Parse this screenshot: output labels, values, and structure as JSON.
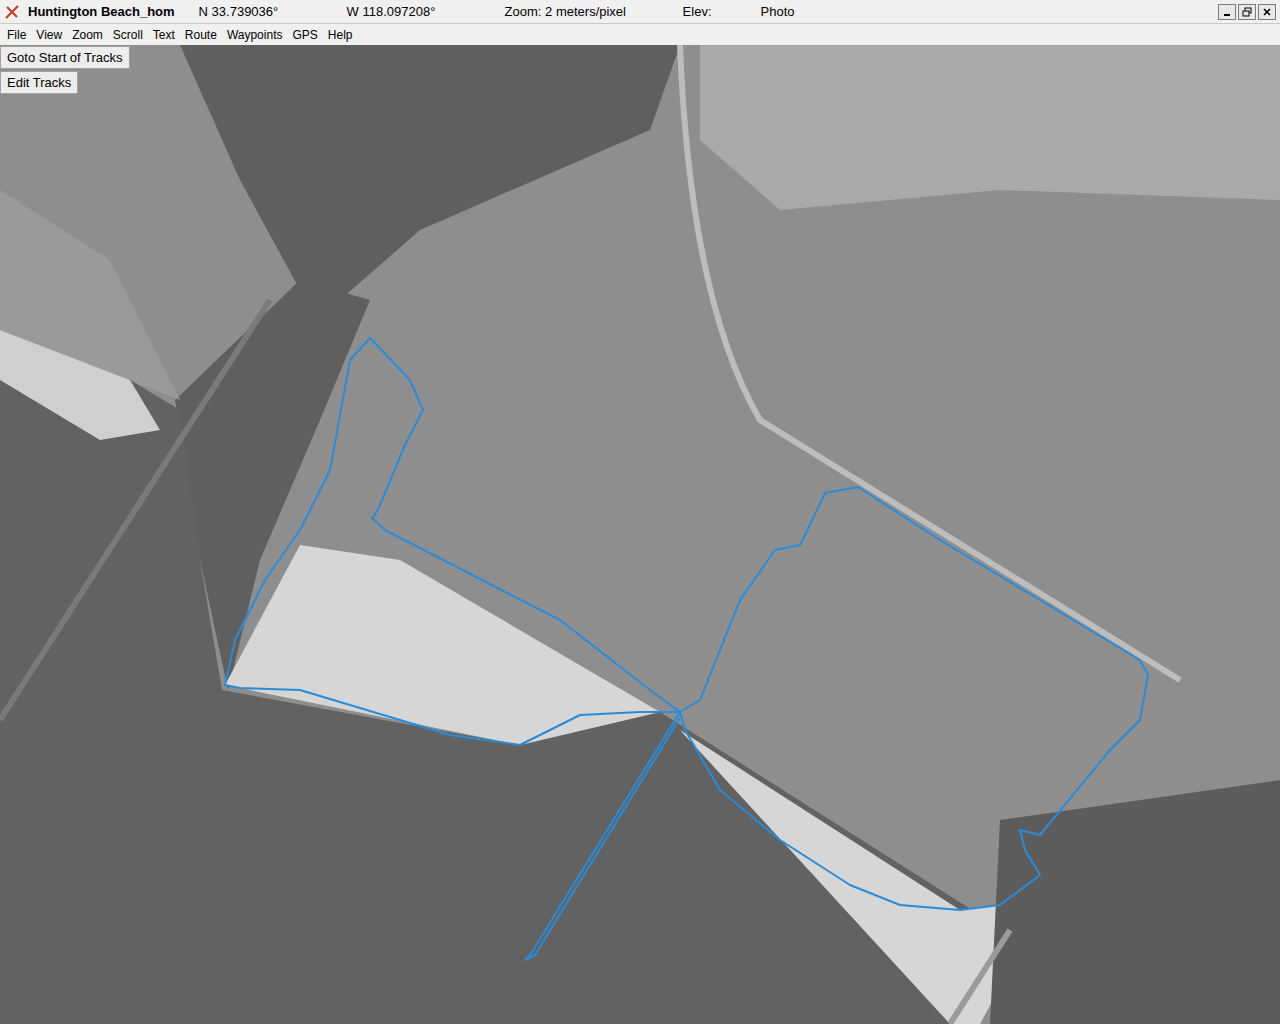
{
  "window": {
    "title": "Huntington Beach_hom",
    "latitude": "N 33.739036°",
    "longitude": "W 118.097208°",
    "zoom": "Zoom: 2 meters/pixel",
    "elevation": "Elev:",
    "layer": "Photo"
  },
  "menu": [
    "File",
    "View",
    "Zoom",
    "Scroll",
    "Text",
    "Route",
    "Waypoints",
    "GPS",
    "Help"
  ],
  "map_buttons": [
    "Goto Start of Tracks",
    "Edit Tracks"
  ],
  "track": {
    "color": "#2b8bd6",
    "segments": [
      [
        [
          680,
          712
        ],
        [
          650,
          690
        ],
        [
          560,
          620
        ],
        [
          385,
          530
        ],
        [
          372,
          518
        ],
        [
          378,
          510
        ],
        [
          405,
          445
        ],
        [
          423,
          410
        ],
        [
          410,
          380
        ],
        [
          370,
          338
        ],
        [
          350,
          360
        ],
        [
          330,
          470
        ],
        [
          300,
          530
        ],
        [
          265,
          580
        ],
        [
          235,
          640
        ],
        [
          225,
          685
        ],
        [
          240,
          688
        ],
        [
          300,
          690
        ],
        [
          450,
          735
        ],
        [
          520,
          745
        ],
        [
          580,
          715
        ],
        [
          640,
          712
        ],
        [
          660,
          712
        ],
        [
          680,
          712
        ]
      ],
      [
        [
          680,
          712
        ],
        [
          530,
          955
        ],
        [
          525,
          960
        ],
        [
          535,
          955
        ],
        [
          680,
          718
        ]
      ],
      [
        [
          680,
          712
        ],
        [
          700,
          700
        ],
        [
          740,
          600
        ],
        [
          775,
          550
        ],
        [
          800,
          545
        ],
        [
          805,
          535
        ],
        [
          825,
          493
        ],
        [
          858,
          487
        ],
        [
          940,
          540
        ],
        [
          1140,
          660
        ],
        [
          1148,
          675
        ],
        [
          1140,
          720
        ],
        [
          1110,
          750
        ],
        [
          1040,
          835
        ],
        [
          1020,
          830
        ],
        [
          1025,
          850
        ],
        [
          1040,
          875
        ],
        [
          1000,
          905
        ],
        [
          960,
          910
        ],
        [
          900,
          905
        ],
        [
          850,
          885
        ],
        [
          780,
          840
        ],
        [
          720,
          790
        ],
        [
          685,
          730
        ],
        [
          680,
          712
        ]
      ]
    ]
  }
}
